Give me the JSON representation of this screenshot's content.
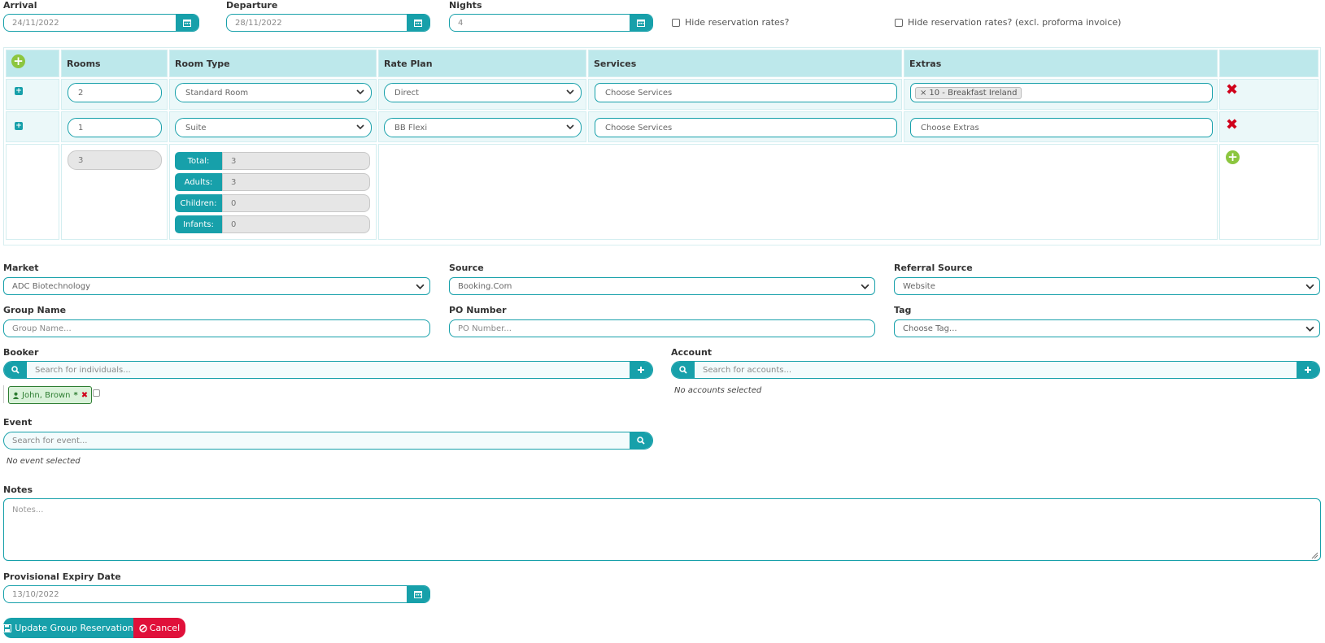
{
  "dates": {
    "arrival_label": "Arrival",
    "arrival_value": "24/11/2022",
    "departure_label": "Departure",
    "departure_value": "28/11/2022",
    "nights_label": "Nights",
    "nights_value": "4",
    "hide_rates_label": "Hide reservation rates?",
    "hide_rates_excl_label": "Hide reservation rates? (excl. proforma invoice)"
  },
  "rooms_table": {
    "headers": [
      "Rooms",
      "Room Type",
      "Rate Plan",
      "Services",
      "Extras"
    ],
    "rows": [
      {
        "rooms": "2",
        "room_type": "Standard Room",
        "rate_plan": "Direct",
        "services_placeholder": "Choose Services",
        "extras_tag": "10 - Breakfast Ireland",
        "extras_tag_remove": "×"
      },
      {
        "rooms": "1",
        "room_type": "Suite",
        "rate_plan": "BB Flexi",
        "services_placeholder": "Choose Services",
        "extras_placeholder": "Choose Extras"
      }
    ],
    "total_rooms": "3",
    "occupancy": [
      {
        "label": "Total:",
        "value": "3"
      },
      {
        "label": "Adults:",
        "value": "3"
      },
      {
        "label": "Children:",
        "value": "0"
      },
      {
        "label": "Infants:",
        "value": "0"
      }
    ]
  },
  "details": {
    "market_label": "Market",
    "market_value": "ADC Biotechnology",
    "source_label": "Source",
    "source_value": "Booking.Com",
    "referral_label": "Referral Source",
    "referral_value": "Website",
    "group_name_label": "Group Name",
    "group_name_placeholder": "Group Name...",
    "po_label": "PO Number",
    "po_placeholder": "PO Number...",
    "tag_label": "Tag",
    "tag_placeholder": "Choose Tag..."
  },
  "booker": {
    "label": "Booker",
    "search_placeholder": "Search for individuals...",
    "selected_name": "John, Brown",
    "selected_marker": "*"
  },
  "account": {
    "label": "Account",
    "search_placeholder": "Search for accounts...",
    "empty_text": "No accounts selected"
  },
  "event": {
    "label": "Event",
    "search_placeholder": "Search for event...",
    "empty_text": "No event selected"
  },
  "notes": {
    "label": "Notes",
    "placeholder": "Notes..."
  },
  "expiry": {
    "label": "Provisional Expiry Date",
    "value": "13/10/2022"
  },
  "actions": {
    "update_label": "Update Group Reservation",
    "cancel_label": "Cancel"
  },
  "colors": {
    "accent": "#17a0aa",
    "header_bg": "#bde8eb",
    "danger": "#d0021b",
    "add_green": "#8cc63f",
    "cancel": "#e0103a"
  }
}
